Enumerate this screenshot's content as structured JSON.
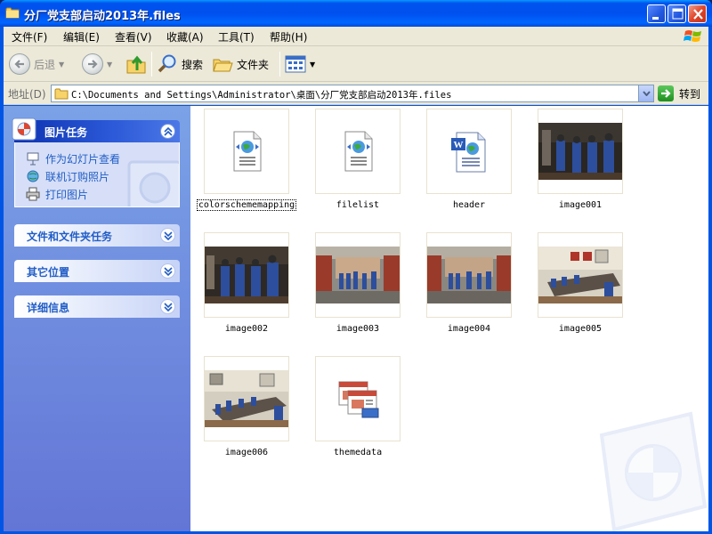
{
  "window": {
    "title": "分厂党支部启动2013年.files"
  },
  "menu": {
    "items": [
      "文件(F)",
      "编辑(E)",
      "查看(V)",
      "收藏(A)",
      "工具(T)",
      "帮助(H)"
    ]
  },
  "toolbar": {
    "back_label": "后退",
    "search_label": "搜索",
    "folders_label": "文件夹"
  },
  "address": {
    "label": "地址(D)",
    "path": "C:\\Documents and Settings\\Administrator\\桌面\\分厂党支部启动2013年.files",
    "go_label": "转到"
  },
  "taskpane": {
    "picture_tasks": {
      "title": "图片任务",
      "tasks": [
        "作为幻灯片查看",
        "联机订购照片",
        "打印图片"
      ]
    },
    "file_folder_tasks": {
      "title": "文件和文件夹任务"
    },
    "other_places": {
      "title": "其它位置"
    },
    "details": {
      "title": "详细信息"
    }
  },
  "files": [
    {
      "name": "colorschememapping",
      "kind": "xml-web"
    },
    {
      "name": "filelist",
      "kind": "xml-web"
    },
    {
      "name": "header",
      "kind": "word-doc"
    },
    {
      "name": "image001",
      "kind": "photo"
    },
    {
      "name": "image002",
      "kind": "photo"
    },
    {
      "name": "image003",
      "kind": "photo"
    },
    {
      "name": "image004",
      "kind": "photo"
    },
    {
      "name": "image005",
      "kind": "photo"
    },
    {
      "name": "image006",
      "kind": "photo"
    },
    {
      "name": "themedata",
      "kind": "theme"
    }
  ],
  "colors": {
    "titlebar": "#0054e3",
    "taskpane_top": "#7ba2e7",
    "taskpane_bottom": "#6375d6",
    "task_link": "#215dc6"
  }
}
